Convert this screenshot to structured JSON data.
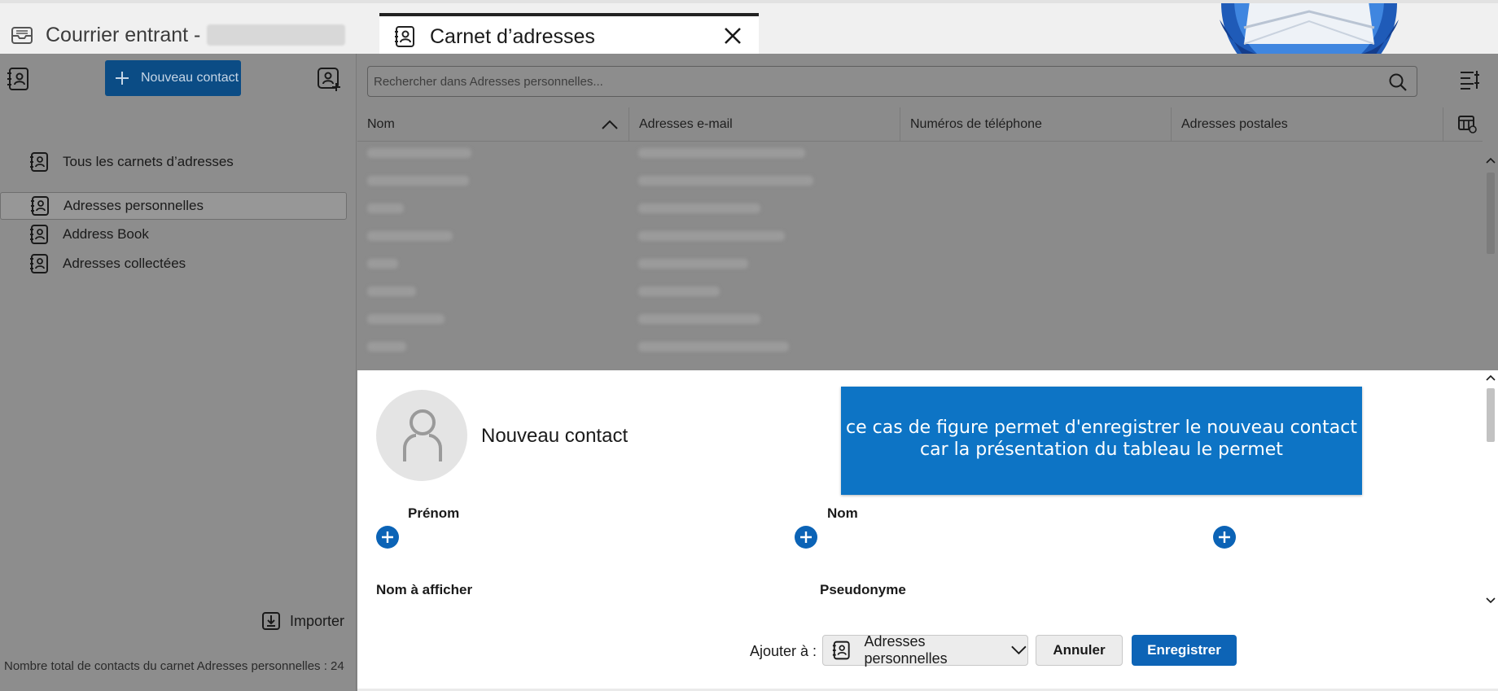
{
  "tabs": {
    "inactive_label": "Courrier entrant -",
    "active_label": "Carnet d’adresses"
  },
  "sidebar": {
    "new_contact_label": "Nouveau contact",
    "items": [
      {
        "label": "Tous les carnets d’adresses"
      },
      {
        "label": "Adresses personnelles"
      },
      {
        "label": "Address Book"
      },
      {
        "label": "Adresses collectées"
      }
    ],
    "import_label": "Importer",
    "footer": "Nombre total de contacts du carnet Adresses personnelles : 24"
  },
  "search": {
    "placeholder": "Rechercher dans Adresses personnelles..."
  },
  "table": {
    "columns": [
      "Nom",
      "Adresses e-mail",
      "Numéros de téléphone",
      "Adresses postales"
    ]
  },
  "editor": {
    "title": "Nouveau contact",
    "callout_line1": "ce cas de figure  permet d'enregistrer le nouveau contact",
    "callout_line2": "car la présentation du tableau le permet",
    "field_prenom": "Prénom",
    "field_nom": "Nom",
    "field_display": "Nom à afficher",
    "field_nickname": "Pseudonyme"
  },
  "footer": {
    "add_to_label": "Ajouter à :",
    "book_value": "Adresses personnelles",
    "cancel_label": "Annuler",
    "save_label": "Enregistrer"
  },
  "colors": {
    "accent": "#0d74c5",
    "save": "#0d64b6",
    "new_contact_dimmed": "#0b4c85"
  }
}
